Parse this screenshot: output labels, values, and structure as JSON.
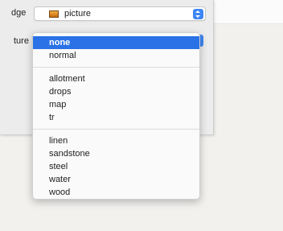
{
  "panel": {
    "edge_label": "dge",
    "texture_label": "ture",
    "edge_value": "picture"
  },
  "menu": {
    "groups": [
      [
        "none",
        "normal"
      ],
      [
        "allotment",
        "drops",
        "map",
        "tr"
      ],
      [
        "linen",
        "sandstone",
        "steel",
        "water",
        "wood"
      ]
    ],
    "selected": "none"
  },
  "icons": {
    "swatch": "picture-swatch-icon",
    "stepper": "popup-stepper-icon"
  },
  "colors": {
    "accent": "#2a72e6",
    "stepper": "#3d86f5"
  }
}
